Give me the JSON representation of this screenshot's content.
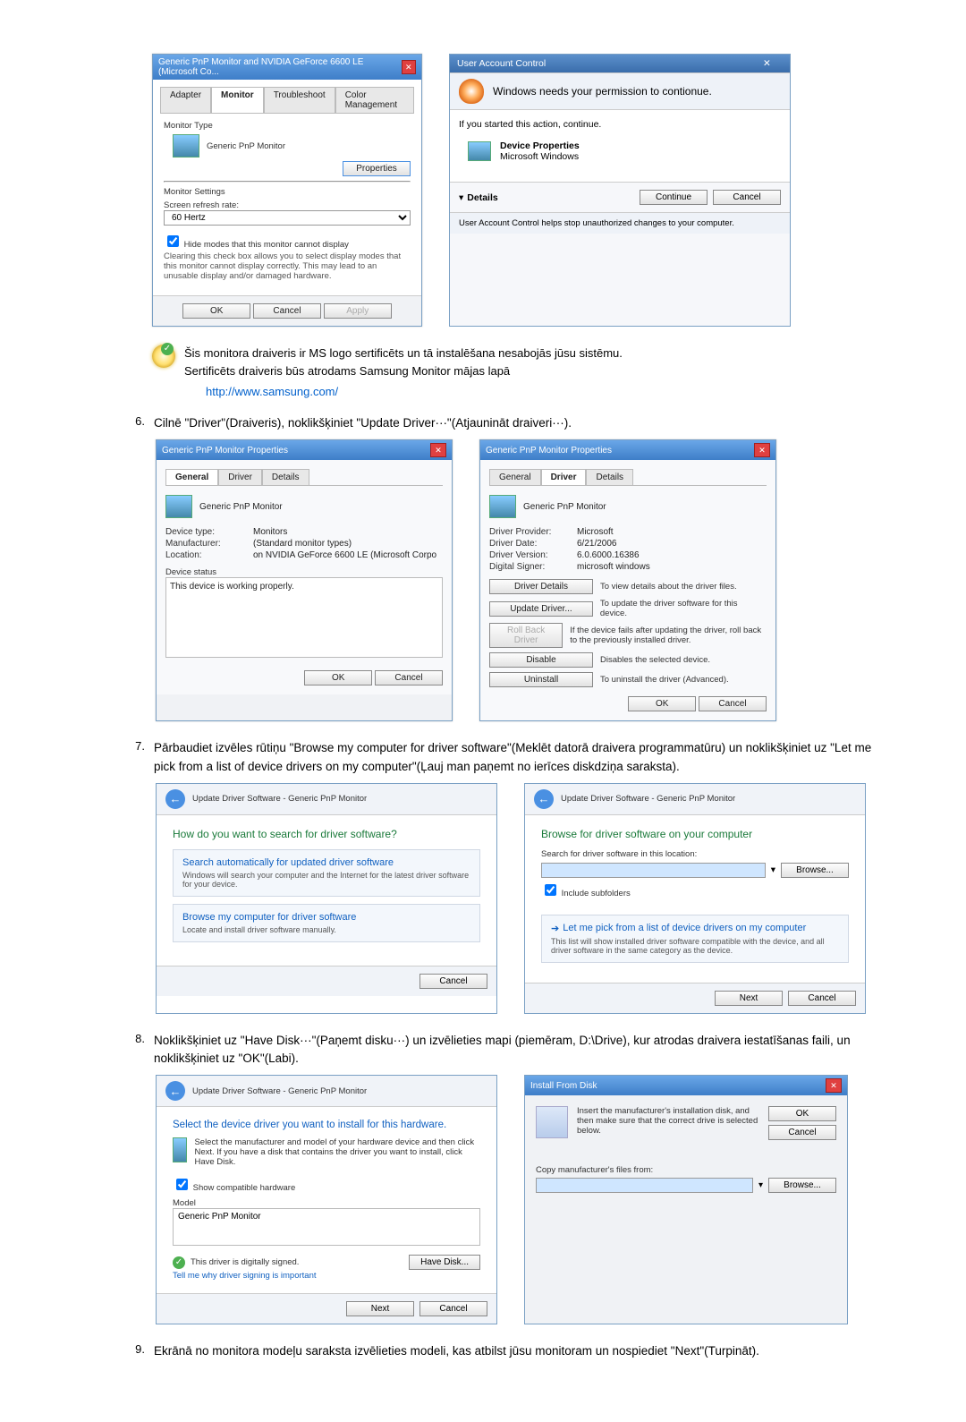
{
  "dlg1": {
    "title": "Generic PnP Monitor and NVIDIA GeForce 6600 LE (Microsoft Co...",
    "tabs": {
      "adapter": "Adapter",
      "monitor": "Monitor",
      "troubleshoot": "Troubleshoot",
      "color": "Color Management"
    },
    "monitorTypeLabel": "Monitor Type",
    "monitorType": "Generic PnP Monitor",
    "propertiesBtn": "Properties",
    "settingsLabel": "Monitor Settings",
    "refreshLabel": "Screen refresh rate:",
    "refreshValue": "60 Hertz",
    "hideModes": "Hide modes that this monitor cannot display",
    "hideModesDesc": "Clearing this check box allows you to select display modes that this monitor cannot display correctly. This may lead to an unusable display and/or damaged hardware.",
    "ok": "OK",
    "cancel": "Cancel",
    "apply": "Apply"
  },
  "uac": {
    "title": "User Account Control",
    "headline": "Windows needs your permission to contionue.",
    "started": "If you started this action, continue.",
    "devProps": "Device Properties",
    "vendor": "Microsoft Windows",
    "details": "Details",
    "continue": "Continue",
    "cancel": "Cancel",
    "footer": "User Account Control helps stop unauthorized changes to your computer."
  },
  "note": {
    "l1": "Šis monitora draiveris ir MS logo sertificēts un tā instalēšana nesabojās jūsu sistēmu.",
    "l2": "Sertificēts draiveris būs atrodams Samsung Monitor mājas lapā",
    "link": "http://www.samsung.com/"
  },
  "step6": {
    "num": "6.",
    "text": "Cilnē \"Driver\"(Draiveris), noklikšķiniet \"Update Driver···\"(Atjaunināt draiveri···)."
  },
  "propsGeneral": {
    "title": "Generic PnP Monitor Properties",
    "tabs": {
      "general": "General",
      "driver": "Driver",
      "details": "Details"
    },
    "name": "Generic PnP Monitor",
    "devType": "Device type:",
    "devTypeV": "Monitors",
    "mfr": "Manufacturer:",
    "mfrV": "(Standard monitor types)",
    "loc": "Location:",
    "locV": "on NVIDIA GeForce 6600 LE (Microsoft Corpo",
    "statusLbl": "Device status",
    "status": "This device is working properly.",
    "ok": "OK",
    "cancel": "Cancel"
  },
  "propsDriver": {
    "title": "Generic PnP Monitor Properties",
    "name": "Generic PnP Monitor",
    "provider": "Driver Provider:",
    "providerV": "Microsoft",
    "date": "Driver Date:",
    "dateV": "6/21/2006",
    "version": "Driver Version:",
    "versionV": "6.0.6000.16386",
    "signer": "Digital Signer:",
    "signerV": "microsoft windows",
    "ddBtn": "Driver Details",
    "ddTxt": "To view details about the driver files.",
    "udBtn": "Update Driver...",
    "udTxt": "To update the driver software for this device.",
    "rbBtn": "Roll Back Driver",
    "rbTxt": "If the device fails after updating the driver, roll back to the previously installed driver.",
    "disBtn": "Disable",
    "disTxt": "Disables the selected device.",
    "unBtn": "Uninstall",
    "unTxt": "To uninstall the driver (Advanced).",
    "ok": "OK",
    "cancel": "Cancel"
  },
  "step7": {
    "num": "7.",
    "text": "Pārbaudiet izvēles rūtiņu \"Browse my computer for driver software\"(Meklēt datorā draivera programmatūru) un noklikšķiniet uz \"Let me pick from a list of device drivers on my computer\"(Ļauj man paņemt no ierīces diskdziņa saraksta)."
  },
  "wiz1": {
    "crumb": "Update Driver Software - Generic PnP Monitor",
    "q": "How do you want to search for driver software?",
    "opt1t": "Search automatically for updated driver software",
    "opt1d": "Windows will search your computer and the Internet for the latest driver software for your device.",
    "opt2t": "Browse my computer for driver software",
    "opt2d": "Locate and install driver software manually.",
    "cancel": "Cancel"
  },
  "wiz2": {
    "crumb": "Update Driver Software - Generic PnP Monitor",
    "h": "Browse for driver software on your computer",
    "searchLbl": "Search for driver software in this location:",
    "browse": "Browse...",
    "sub": "Include subfolders",
    "pickT": "Let me pick from a list of device drivers on my computer",
    "pickD": "This list will show installed driver software compatible with the device, and all driver software in the same category as the device.",
    "next": "Next",
    "cancel": "Cancel"
  },
  "step8": {
    "num": "8.",
    "text": "Noklikšķiniet uz \"Have Disk···\"(Paņemt disku···) un izvēlieties mapi (piemēram, D:\\Drive), kur atrodas draivera iestatīšanas faili, un noklikšķiniet uz \"OK\"(Labi)."
  },
  "wiz3": {
    "crumb": "Update Driver Software - Generic PnP Monitor",
    "h": "Select the device driver you want to install for this hardware.",
    "hint": "Select the manufacturer and model of your hardware device and then click Next. If you have a disk that contains the driver you want to install, click Have Disk.",
    "compat": "Show compatible hardware",
    "modelLbl": "Model",
    "model": "Generic PnP Monitor",
    "signed": "This driver is digitally signed.",
    "tell": "Tell me why driver signing is important",
    "haveDisk": "Have Disk...",
    "next": "Next",
    "cancel": "Cancel"
  },
  "ifd": {
    "title": "Install From Disk",
    "msg": "Insert the manufacturer's installation disk, and then make sure that the correct drive is selected below.",
    "ok": "OK",
    "cancel": "Cancel",
    "copyLbl": "Copy manufacturer's files from:",
    "browse": "Browse..."
  },
  "step9": {
    "num": "9.",
    "text": "Ekrānā no monitora modeļu saraksta izvēlieties modeli, kas atbilst jūsu monitoram un nospiediet \"Next\"(Turpināt)."
  }
}
